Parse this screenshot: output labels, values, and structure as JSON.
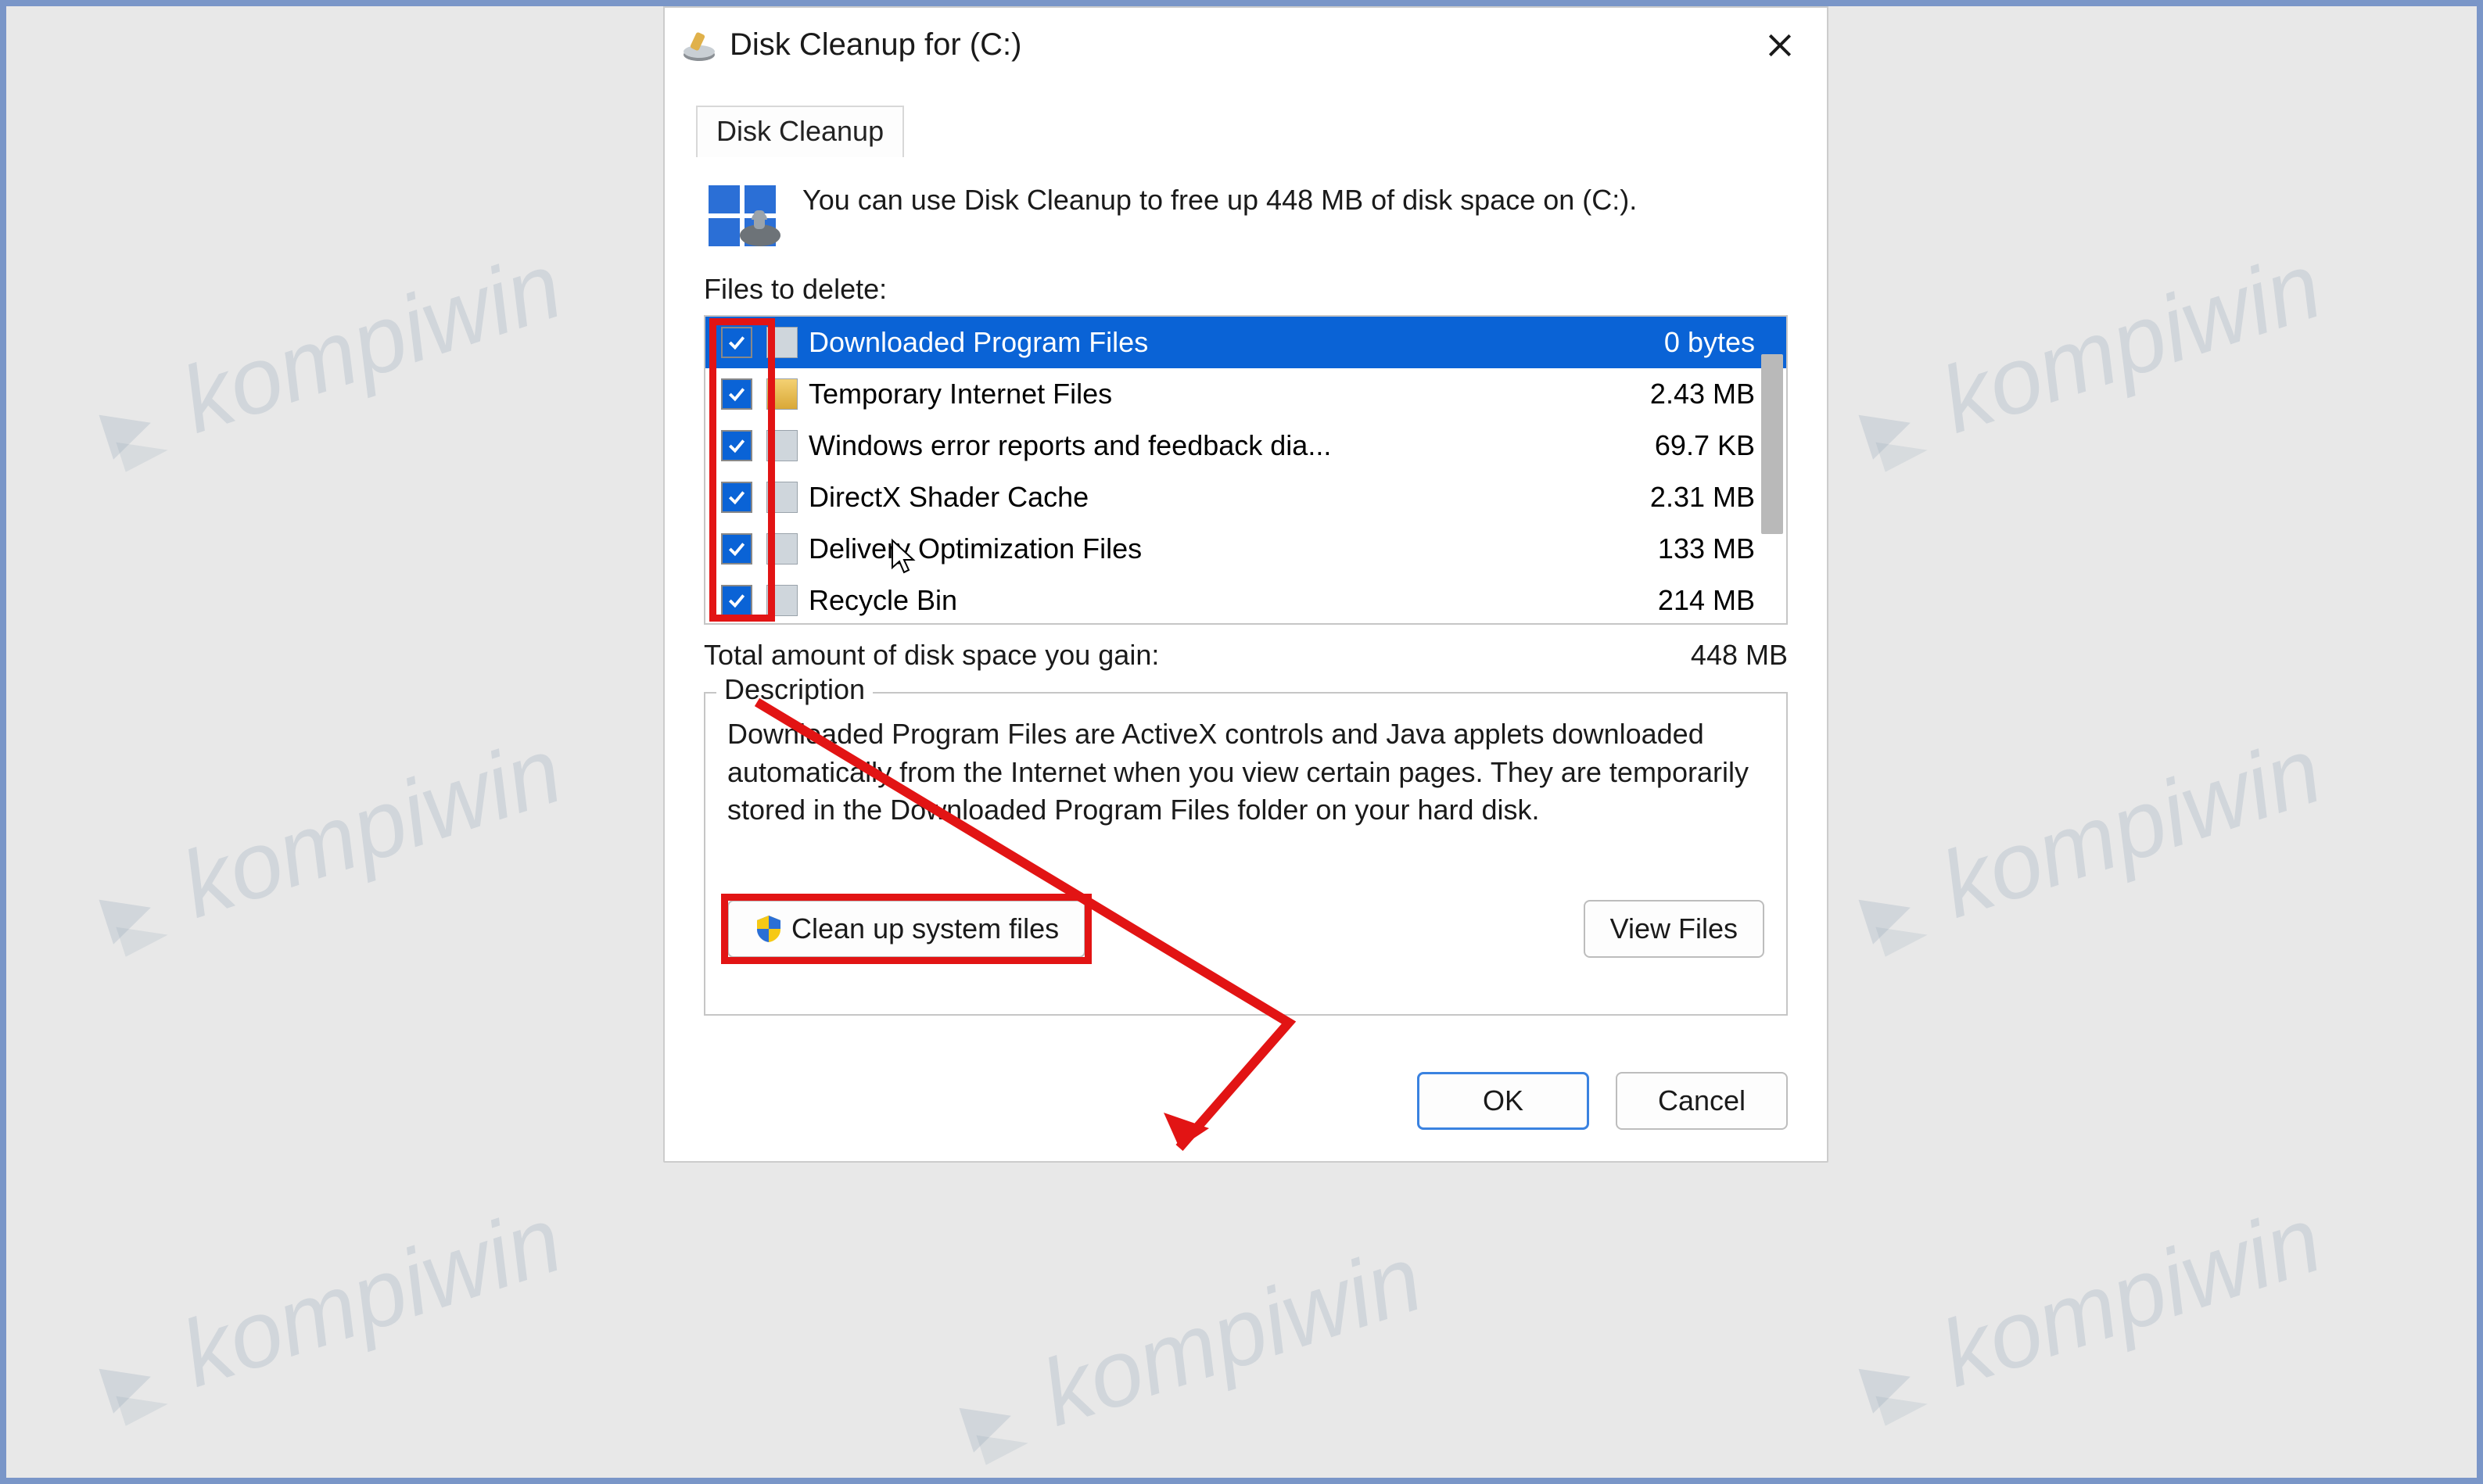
{
  "window": {
    "title": "Disk Cleanup for  (C:)"
  },
  "tab": {
    "label": "Disk Cleanup"
  },
  "info": {
    "text": "You can use Disk Cleanup to free up 448 MB of disk space on  (C:)."
  },
  "section": {
    "files_label": "Files to delete:"
  },
  "files": [
    {
      "name": "Downloaded Program Files",
      "size": "0 bytes",
      "checked": true,
      "selected": true
    },
    {
      "name": "Temporary Internet Files",
      "size": "2.43 MB",
      "checked": true,
      "selected": false
    },
    {
      "name": "Windows error reports and feedback dia...",
      "size": "69.7 KB",
      "checked": true,
      "selected": false
    },
    {
      "name": "DirectX Shader Cache",
      "size": "2.31 MB",
      "checked": true,
      "selected": false
    },
    {
      "name": "Delivery Optimization Files",
      "size": "133 MB",
      "checked": true,
      "selected": false
    },
    {
      "name": "Recycle Bin",
      "size": "214 MB",
      "checked": true,
      "selected": false
    }
  ],
  "total": {
    "label": "Total amount of disk space you gain:",
    "value": "448 MB"
  },
  "description": {
    "title": "Description",
    "text": "Downloaded Program Files are ActiveX controls and Java applets downloaded automatically from the Internet when you view certain pages. They are temporarily stored in the Downloaded Program Files folder on your hard disk."
  },
  "buttons": {
    "clean_system": "Clean up system files",
    "view_files": "View Files",
    "ok": "OK",
    "cancel": "Cancel"
  },
  "watermark": "kompiwin"
}
